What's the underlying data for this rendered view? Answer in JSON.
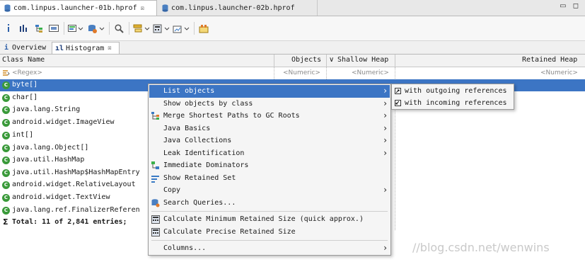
{
  "editor_tabs": [
    {
      "label": "com.linpus.launcher-01b.hprof",
      "close": "☒"
    },
    {
      "label": "com.linpus.launcher-02b.hprof"
    }
  ],
  "window_controls": "▭ ◻",
  "toolbar": {
    "icons": [
      "info-icon",
      "histogram-icon",
      "dominator-tree-icon",
      "oql-icon",
      "thread-overview-icon",
      "run-report-icon",
      "query-browser-icon",
      "search-icon",
      "group-by-icon",
      "calculate-retained-icon",
      "export-icon",
      "compare-icon"
    ]
  },
  "inner_tabs": [
    {
      "icon": "i",
      "label": "Overview"
    },
    {
      "icon": "ıl",
      "label": "Histogram",
      "close": "☒"
    }
  ],
  "table": {
    "columns": {
      "class_name": "Class Name",
      "objects": "Objects",
      "shallow_heap": "Shallow Heap",
      "retained_heap": "Retained Heap",
      "sort_indicator": "∨"
    },
    "filters": {
      "class_name": "<Regex>",
      "objects": "<Numeric>",
      "shallow_heap": "<Numeric>",
      "retained_heap": "<Numeric>"
    },
    "rows": [
      {
        "name": "byte[]",
        "selected": true
      },
      {
        "name": "char[]"
      },
      {
        "name": "java.lang.String"
      },
      {
        "name": "android.widget.ImageView"
      },
      {
        "name": "int[]"
      },
      {
        "name": "java.lang.Object[]"
      },
      {
        "name": "java.util.HashMap"
      },
      {
        "name": "java.util.HashMap$HashMapEntry"
      },
      {
        "name": "android.widget.RelativeLayout"
      },
      {
        "name": "android.widget.TextView"
      },
      {
        "name": "java.lang.ref.FinalizerReferen"
      }
    ],
    "total": "Total: 11 of 2,841 entries;",
    "total_icon": "Σ"
  },
  "context_menu": {
    "items": [
      {
        "label": "List objects",
        "submenu": true,
        "highlighted": true
      },
      {
        "label": "Show objects by class",
        "submenu": true
      },
      {
        "label": "Merge Shortest Paths to GC Roots",
        "submenu": true,
        "icon": "merge-paths-icon"
      },
      {
        "label": "Java Basics",
        "submenu": true
      },
      {
        "label": "Java Collections",
        "submenu": true
      },
      {
        "label": "Leak Identification",
        "submenu": true
      },
      {
        "label": "Immediate Dominators",
        "icon": "dominators-icon"
      },
      {
        "label": "Show Retained Set",
        "icon": "retained-set-icon"
      },
      {
        "label": "Copy",
        "submenu": true
      },
      {
        "label": "Search Queries...",
        "icon": "search-queries-icon"
      },
      {
        "label": "Calculate Minimum Retained Size (quick approx.)",
        "icon": "calculator-icon"
      },
      {
        "label": "Calculate Precise Retained Size",
        "icon": "calculator-icon"
      },
      {
        "label": "Columns...",
        "submenu": true
      }
    ],
    "submenu_arrow": "›"
  },
  "submenu": {
    "items": [
      {
        "label": "with outgoing references",
        "icon": "outgoing-references-icon"
      },
      {
        "label": "with incoming references",
        "icon": "incoming-references-icon"
      }
    ]
  },
  "watermark": "//blog.csdn.net/wenwins",
  "colors": {
    "selection": "#3c75c4",
    "class_icon": "#3a9a3a"
  }
}
